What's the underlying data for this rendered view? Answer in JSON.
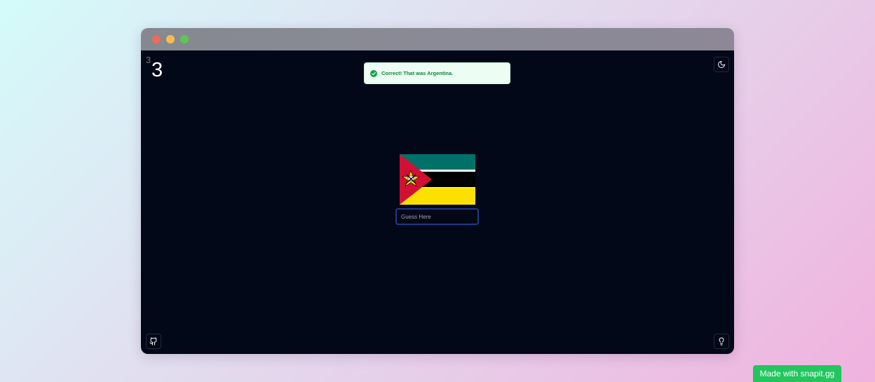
{
  "window": {
    "traffic_lights": [
      {
        "name": "close",
        "color": "#ee6a5f"
      },
      {
        "name": "minimize",
        "color": "#f5bd4f"
      },
      {
        "name": "maximize",
        "color": "#61c554"
      }
    ]
  },
  "score": {
    "streak_small": "3",
    "streak_big": "3"
  },
  "toast": {
    "message": "Correct! That was Argentina.",
    "icon": "check-circle-icon",
    "color": "#15803d"
  },
  "flag": {
    "country_shown": "Mozambique",
    "colors": {
      "green": "#007168",
      "black": "#000000",
      "yellow": "#fce100",
      "red": "#d21034",
      "white": "#ffffff"
    }
  },
  "guess_input": {
    "placeholder": "Guess Here",
    "value": ""
  },
  "buttons": {
    "theme_icon": "moon-icon",
    "github_icon": "github-icon",
    "hint_icon": "lightbulb-icon"
  },
  "footer": {
    "label": "Made with snapit.gg"
  }
}
